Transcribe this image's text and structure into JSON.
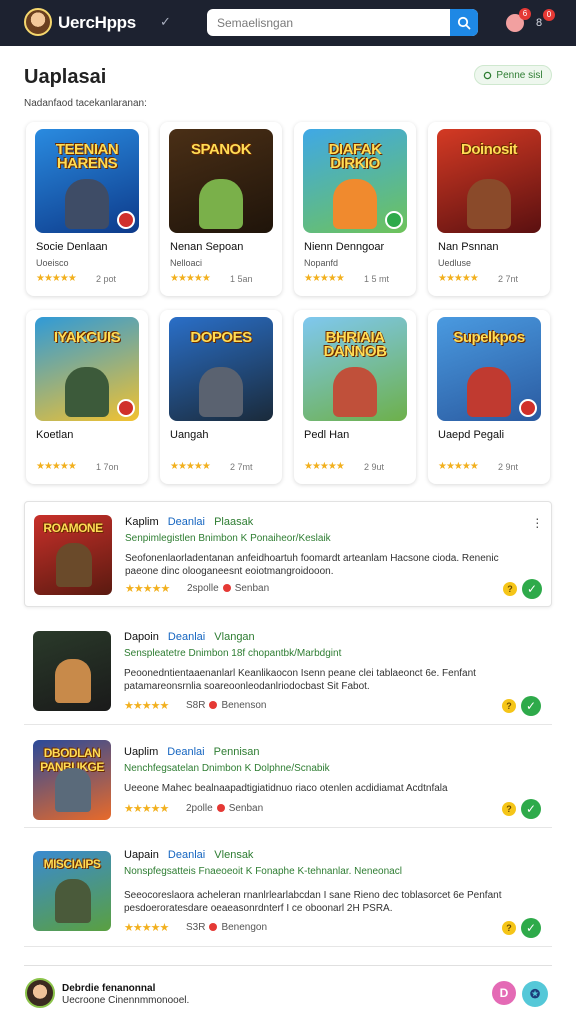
{
  "app": {
    "brand": "UercHpps",
    "brand_check": "✓",
    "notification_count": "6",
    "user_badge": "0",
    "user_initials": "8"
  },
  "search": {
    "placeholder": "Semaelisngan",
    "value": ""
  },
  "header": {
    "title": "Uaplasai",
    "filter_label": "Penne sisl",
    "subtitle": "Nadanfaod tacekanlaranan:"
  },
  "grid": [
    {
      "title": "Socie Denlaan",
      "sub": "Uoeisco",
      "rating": "★★★★★",
      "count": "2 pot",
      "art": "TEENIAN HARENS",
      "color_top": "#2a8be0",
      "color_bot": "#0d3a8a",
      "figure": "#3e4c66",
      "badge": "#d0302a"
    },
    {
      "title": "Nenan Sepoan",
      "sub": "Nelloaci",
      "rating": "★★★★★",
      "count": "1 5an",
      "art": "SPANOK",
      "color_top": "#4a2f16",
      "color_bot": "#1f140a",
      "figure": "#7ab04a",
      "badge": ""
    },
    {
      "title": "Nienn Denngoar",
      "sub": "Nopanfd",
      "rating": "★★★★★",
      "count": "1 5 mt",
      "art": "DIAFAK DIRKIO",
      "color_top": "#3fa8e6",
      "color_bot": "#6ec35a",
      "figure": "#f08a2e",
      "badge": "#2eaa4a"
    },
    {
      "title": "Nan Psnnan",
      "sub": "Uedluse",
      "rating": "★★★★★",
      "count": "2 7nt",
      "art": "Doinosit",
      "color_top": "#d43a24",
      "color_bot": "#5a1010",
      "figure": "#8a4a2a",
      "badge": ""
    },
    {
      "title": "Koetlan",
      "sub": "",
      "rating": "★★★★★",
      "count": "1 7on",
      "art": "IYAKCUIS",
      "color_top": "#2f9ad8",
      "color_bot": "#f2c230",
      "figure": "#3c5a3a",
      "badge": "#d0302a"
    },
    {
      "title": "Uangah",
      "sub": "",
      "rating": "★★★★★",
      "count": "2 7mt",
      "art": "DOPOES",
      "color_top": "#2a6fc8",
      "color_bot": "#1a2a3a",
      "figure": "#5a6270",
      "badge": ""
    },
    {
      "title": "Pedl Han",
      "sub": "",
      "rating": "★★★★★",
      "count": "2 9ut",
      "art": "BHRIAIA DANNOB",
      "color_top": "#7fc8f0",
      "color_bot": "#6db04a",
      "figure": "#c0503a",
      "badge": ""
    },
    {
      "title": "Uaepd Pegali",
      "sub": "",
      "rating": "★★★★★",
      "count": "2 9nt",
      "art": "Supelkpos",
      "color_top": "#4a9ae0",
      "color_bot": "#2a5aa0",
      "figure": "#c03a30",
      "badge": "#d0302a"
    }
  ],
  "list": [
    {
      "name": "Kaplim",
      "cat": "Deanlai",
      "cat2": "Plaasak",
      "tag": "Senpimlegistlen  Bnimbon K Ponaiheor/Keslaik",
      "desc": "Seofonenlaorladentanan anfeidhoartuh foomardt arteanlam Hacsone cioda. Renenic paeone dinc olooganeesnt eoiotmangroidooon.",
      "rating": "★★★★★",
      "meta": "2spolle",
      "meta2": "Senban",
      "art": "ROAMONE",
      "color_top": "#c8302a",
      "color_bot": "#5a1a10",
      "figure": "#6a4a2a"
    },
    {
      "name": "Dapoin",
      "cat": "Deanlai",
      "cat2": "Vlangan",
      "tag": "Senspleatetre  Dnimbon 18f chopantbk/Marbdgint",
      "desc": "Peoonedntientaaenanlarl Keanlikaocon Isenn peane clei tablaeonct 6e. Fenfant patamareonsrnlia soareoonleodanlriodocbast Sit Fabot.",
      "rating": "★★★★★",
      "meta": "S8R",
      "meta2": "Benenson",
      "art": "",
      "color_top": "#2a3a2a",
      "color_bot": "#1a1a1a",
      "figure": "#c88a4a"
    },
    {
      "name": "Uaplim",
      "cat": "Deanlai",
      "cat2": "Pennisan",
      "tag": "Nenchfegsatelan  Dnimbon K Dolphne/Scnabik",
      "desc": "Ueeone Mahec bealnaapadtigiatidnuo riaco otenlen acdidiamat Acdtnfala",
      "rating": "★★★★★",
      "meta": "2polle",
      "meta2": "Senban",
      "art": "DBODLAN PANBUKGE",
      "color_top": "#2a4a9a",
      "color_bot": "#e86a2a",
      "figure": "#5a6a7a"
    },
    {
      "name": "Uapain",
      "cat": "Deanlai",
      "cat2": "Vlensak",
      "tag": "Nonspfegsatteis  Fnaeoeoit K Fonaphe K-tehnanlar. Neneonacl",
      "desc": "Seeocoreslaora acheleran rnanlrlearlabcdan I sane Rieno dec toblasorcet 6e Penfant pesdoeroratesdare oeaeasonrdnterf I ce oboonarl 2H PSRA.",
      "rating": "★★★★★",
      "meta": "S3R",
      "meta2": "Benengon",
      "art": "MISCIAIPS",
      "color_top": "#3a8ad0",
      "color_bot": "#5aa040",
      "figure": "#4a5a3a"
    }
  ],
  "footer": {
    "name": "Debrdie fenanonnal",
    "sub": "Uecroone Cinennmmonooel.",
    "btn1": "D",
    "btn2": "✪"
  }
}
